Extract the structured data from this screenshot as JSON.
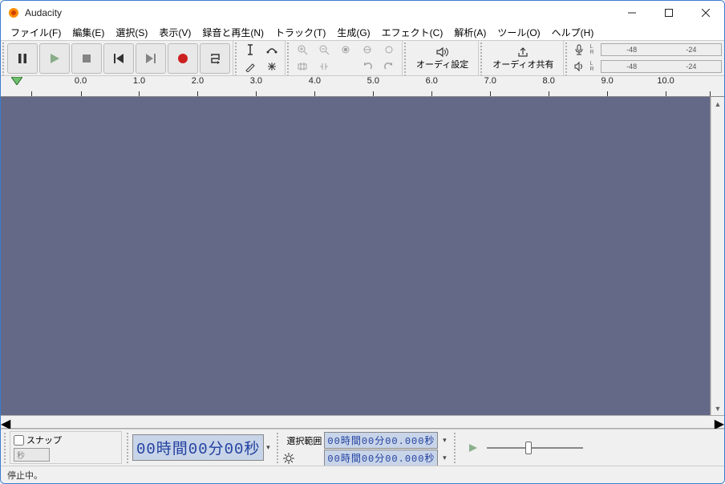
{
  "title": "Audacity",
  "menu": [
    "ファイル(F)",
    "編集(E)",
    "選択(S)",
    "表示(V)",
    "録音と再生(N)",
    "トラック(T)",
    "生成(G)",
    "エフェクト(C)",
    "解析(A)",
    "ツール(O)",
    "ヘルプ(H)"
  ],
  "audio_setup_label": "オーディ設定",
  "audio_share_label": "オーディオ共有",
  "meter_ticks": [
    "-48",
    "-24"
  ],
  "ruler_ticks": [
    "0.0",
    "1.0",
    "2.0",
    "3.0",
    "4.0",
    "5.0",
    "6.0",
    "7.0",
    "8.0",
    "9.0",
    "10.0"
  ],
  "snap_label": "スナップ",
  "snap_unit": "秒",
  "main_time": "00時間00分00秒",
  "selection_label": "選択範囲",
  "sel_start": "00時間00分00.000秒",
  "sel_end": "00時間00分00.000秒",
  "status": "停止中。"
}
